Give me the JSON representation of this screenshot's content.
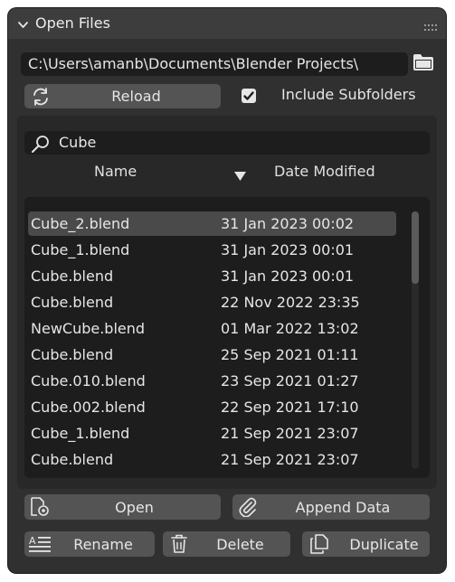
{
  "panel": {
    "title": "Open Files",
    "icons": {
      "collapse": "chevron-down-icon",
      "grip": "drag-grip-icon"
    }
  },
  "path": {
    "value": "C:\\Users\\amanb\\Documents\\Blender Projects\\",
    "browse_icon": "folder-icon"
  },
  "toolbar": {
    "reload_label": "Reload",
    "reload_icon": "refresh-icon",
    "include_subfolders_label": "Include Subfolders",
    "include_subfolders_checked": true
  },
  "search": {
    "value": "Cube",
    "icon": "search-icon"
  },
  "columns": {
    "name": "Name",
    "date": "Date Modified",
    "sort_icon": "sort-descending-icon"
  },
  "files": [
    {
      "name": "Cube_2.blend",
      "date": "31 Jan 2023 00:02",
      "selected": true
    },
    {
      "name": "Cube_1.blend",
      "date": "31 Jan 2023 00:01",
      "selected": false
    },
    {
      "name": "Cube.blend",
      "date": "31 Jan 2023 00:01",
      "selected": false
    },
    {
      "name": "Cube.blend",
      "date": "22 Nov 2022 23:35",
      "selected": false
    },
    {
      "name": "NewCube.blend",
      "date": "01 Mar 2022 13:02",
      "selected": false
    },
    {
      "name": "Cube.blend",
      "date": "25 Sep 2021 01:11",
      "selected": false
    },
    {
      "name": "Cube.010.blend",
      "date": "23 Sep 2021 01:27",
      "selected": false
    },
    {
      "name": "Cube.002.blend",
      "date": "22 Sep 2021 17:10",
      "selected": false
    },
    {
      "name": "Cube_1.blend",
      "date": "21 Sep 2021 23:07",
      "selected": false
    },
    {
      "name": "Cube.blend",
      "date": "21 Sep 2021 23:07",
      "selected": false
    }
  ],
  "actions": {
    "open_label": "Open",
    "append_label": "Append Data",
    "rename_label": "Rename",
    "delete_label": "Delete",
    "duplicate_label": "Duplicate"
  },
  "colors": {
    "panel_bg": "#303030",
    "header_bg": "#3d3d3d",
    "field_bg": "#1d1d1d",
    "button_bg": "#545454",
    "selected_row": "#4a4a4a",
    "text": "#e6e6e6"
  }
}
